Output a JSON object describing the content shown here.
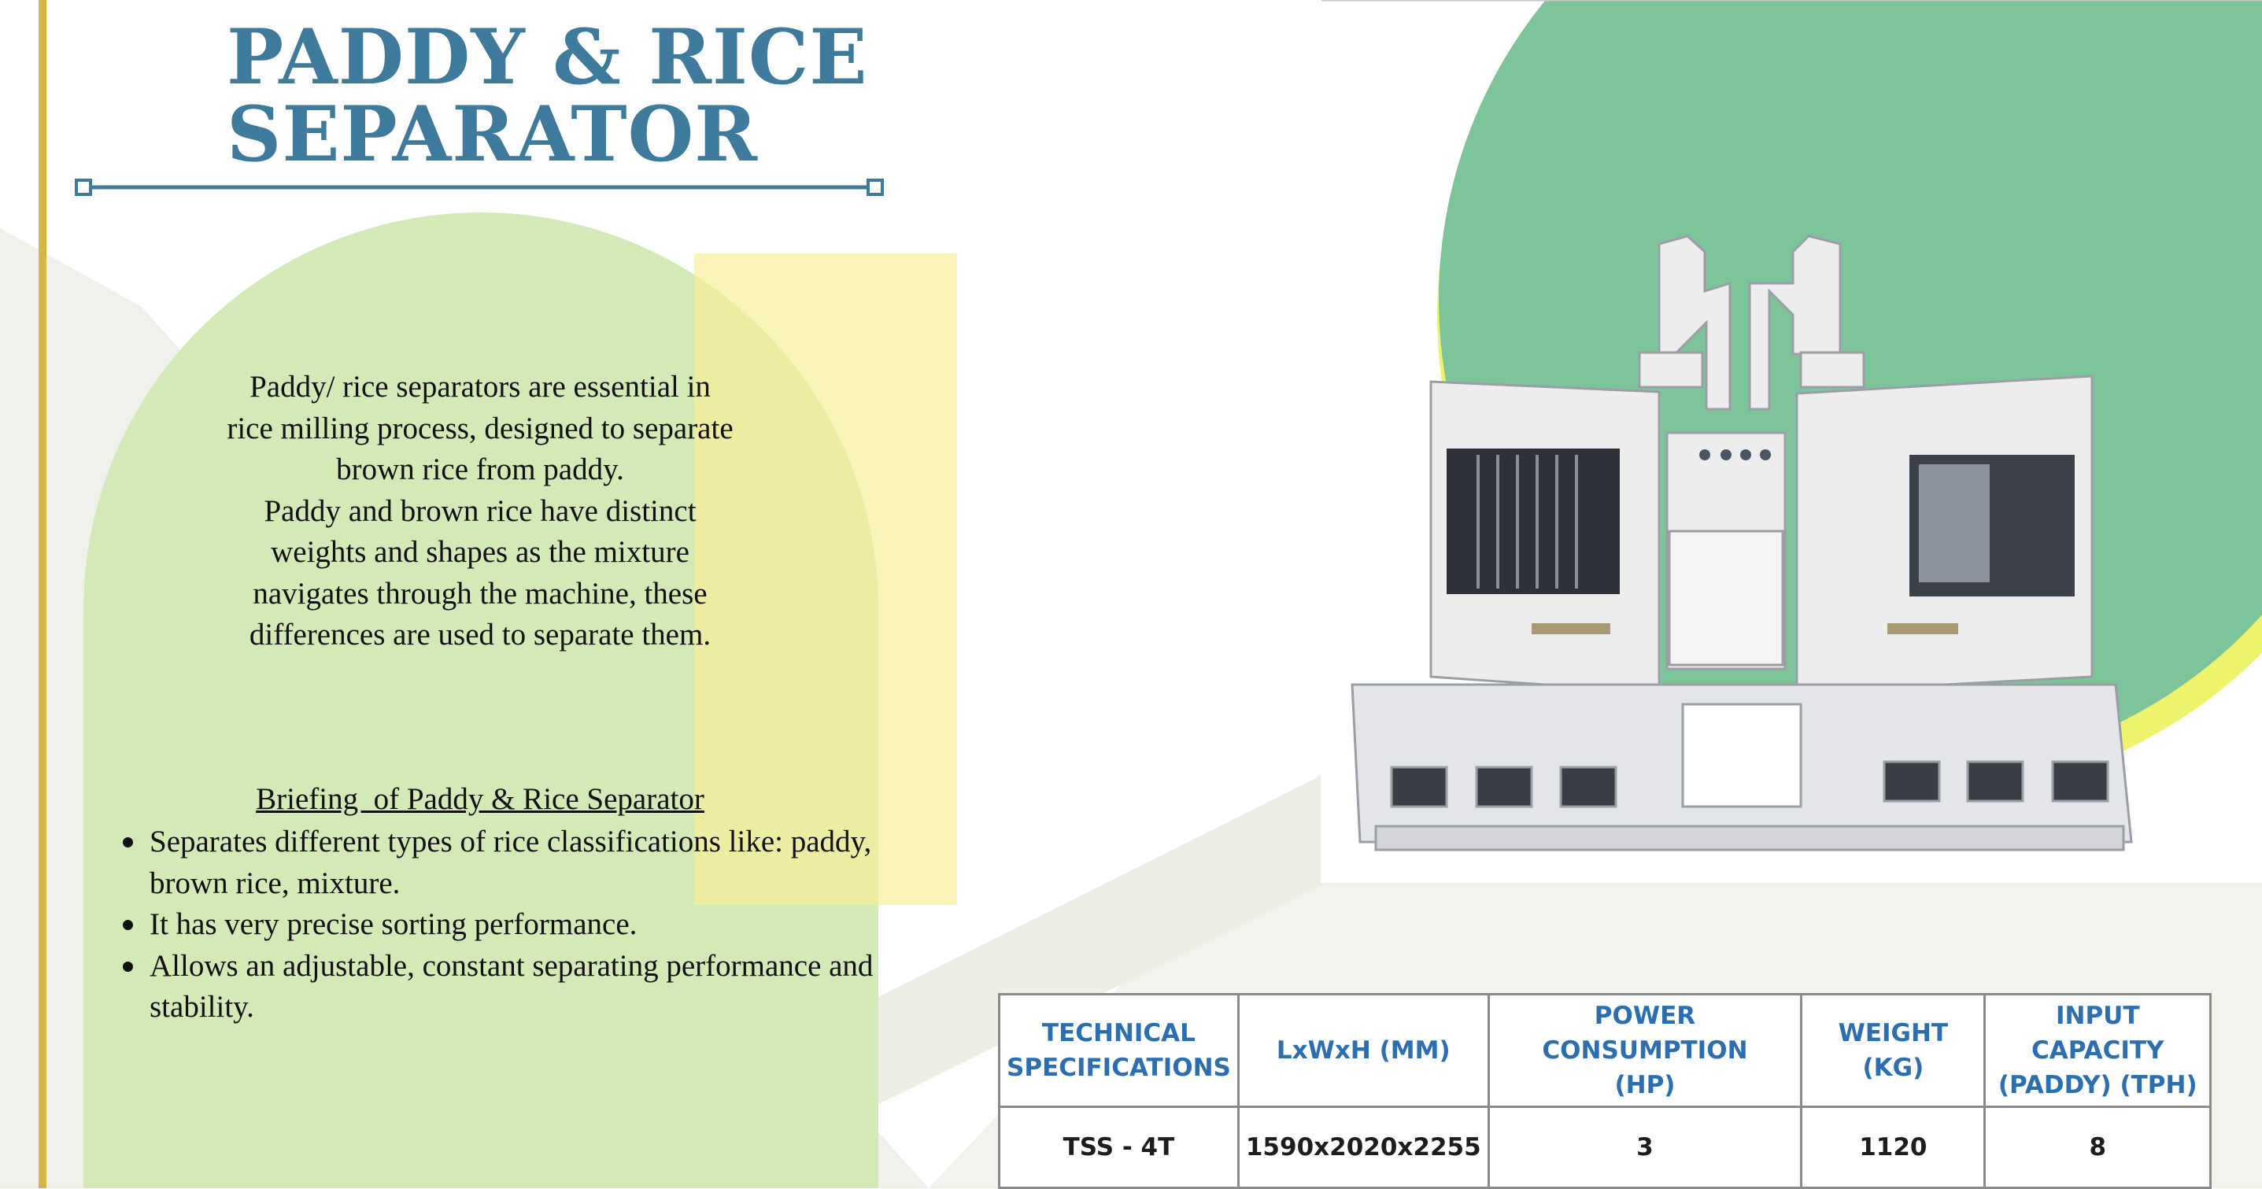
{
  "title": {
    "line1": "PADDY & RICE",
    "line2": "SEPARATOR"
  },
  "intro": {
    "lines": [
      "Paddy/ rice separators are essential in",
      "rice milling process, designed to separate",
      "brown rice from paddy.",
      "Paddy and brown rice have distinct",
      "weights and shapes as the mixture",
      "navigates through the machine, these",
      "differences are used to separate them."
    ]
  },
  "briefing": {
    "title": "Briefing  of Paddy & Rice Separator",
    "bullets": [
      "Separates different types of rice classifications like: paddy, brown rice, mixture.",
      "It has very precise sorting performance.",
      "Allows an adjustable, constant separating performance and stability."
    ]
  },
  "image": {
    "subject": "paddy-rice-separator-machine"
  },
  "spec_table": {
    "headers": [
      [
        "TECHNICAL",
        "SPECIFICATIONS"
      ],
      [
        "LxWxH (MM)"
      ],
      [
        "POWER CONSUMPTION",
        "(HP)"
      ],
      [
        "WEIGHT (KG)"
      ],
      [
        "INPUT CAPACITY",
        "(PADDY) (TPH)"
      ]
    ],
    "rows": [
      [
        "TSS - 4T",
        "1590x2020x2255",
        "3",
        "1120",
        "8"
      ]
    ]
  },
  "colors": {
    "title": "#3e7a9c",
    "gold_bar": "#d6b548",
    "arch_green": "#d3eab6",
    "yellow_panel": "#f7ef98",
    "circle_green": "#7dc49b",
    "table_header": "#2c6fb0"
  }
}
